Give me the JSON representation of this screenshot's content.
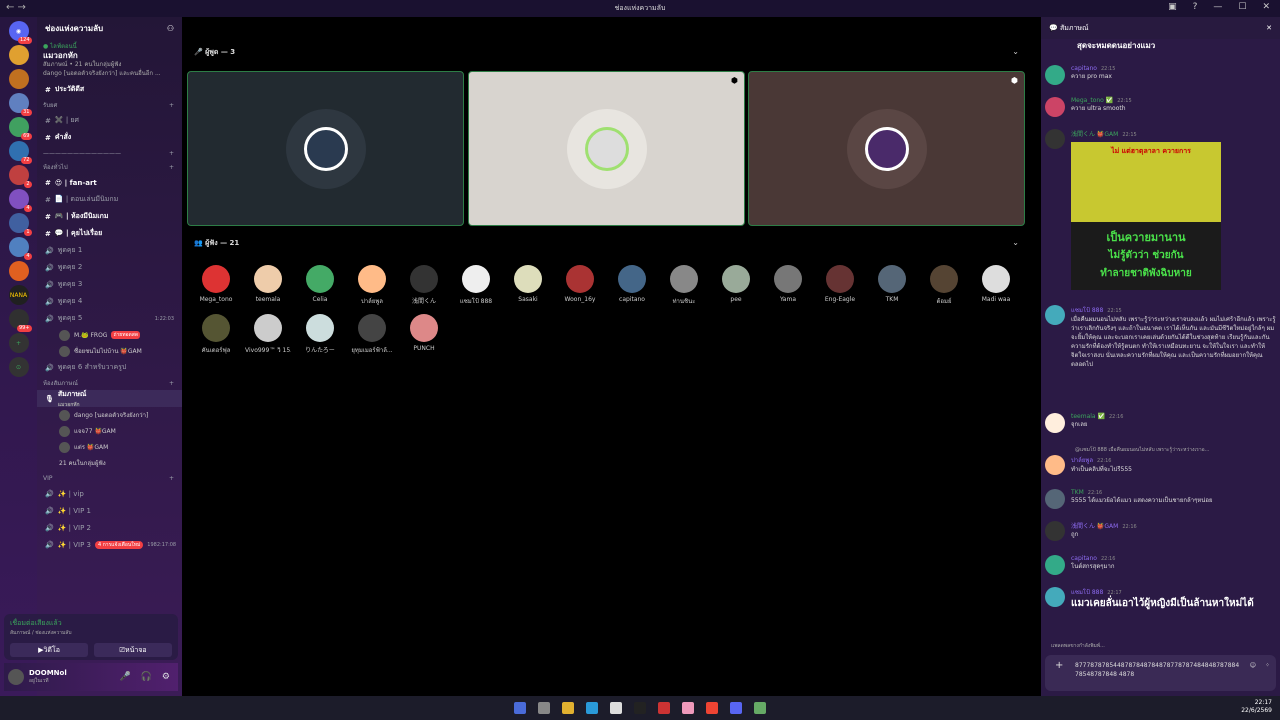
{
  "window": {
    "title": "ช่องแห่งความลับ"
  },
  "server": {
    "name": "ช่องแห่งความลับ"
  },
  "event": {
    "live_label": "● ไลฟ์ตอนนี้",
    "title": "แมวอกหัก",
    "line1": "สัมภาษณ์ • 21 คนในกลุ่มผู้ฟัง",
    "line2": "dango [นอดอตัวจริงยังกว่า] และคนอื่นอีก ..."
  },
  "channels": [
    {
      "name": "ประวัติดีส",
      "bold": true
    },
    {
      "category": "รับยศ"
    },
    {
      "name": "✖️ | ยศ"
    },
    {
      "name": "คำสั่ง",
      "bold": true
    },
    {
      "category": "ห้องทั่วไป"
    },
    {
      "name": "😍 | fan-art",
      "bold": true
    },
    {
      "name": "📄 | ตอนเล่นมีนิมกม"
    },
    {
      "name": "🎮 | ห้องมีนิมเกม",
      "bold": true
    },
    {
      "name": "💬 | คุยไปเรื่อย",
      "bold": true
    },
    {
      "name": "พูดคุย 1"
    },
    {
      "name": "พูดคุย 2"
    },
    {
      "name": "พูดคุย 3"
    },
    {
      "name": "พูดคุย 4"
    },
    {
      "name": "พูดคุย 5",
      "time": "1:22:03"
    }
  ],
  "voice5_users": [
    {
      "name": "M.🐸 FROG",
      "badge": "ถ่ายทอดสด"
    },
    {
      "name": "ซื่อยชนไม่ไปบ้าน 👹GAM"
    }
  ],
  "channels2": [
    {
      "name": "พูดคุย 6 สำหรับวาครูป"
    },
    {
      "category": "ห้องสัมภาษณ์"
    }
  ],
  "stage": {
    "name": "สัมภาษณ์",
    "sub": "แมวอกหัก",
    "users": [
      "dango [นอดอตัวจริงยังกว่า]",
      "แจจ77 👹GAM",
      "แต่ร 👹GAM",
      "21 คนในกลุ่มผู้ฟัง"
    ]
  },
  "vip": {
    "category": "VIP",
    "items": [
      "✨ | vip",
      "✨ | VIP 1",
      "✨ | VIP 2",
      "✨ | VIP 3"
    ],
    "notice": "4 การแจ้งเตือนใหม่",
    "time": "1982:17:08"
  },
  "voicebar": {
    "status": "เชื่อมต่อเสียงแล้ว",
    "where": "สัมภาษณ์ / ช่องแห่งความลับ",
    "video": "วิดีโอ",
    "screen": "หน้าจอ"
  },
  "user": {
    "name": "DOOMNol",
    "status": "อยู่ในเวที"
  },
  "speakers": {
    "label": "ผู้พูด — 3"
  },
  "audience": {
    "label": "ผู้ฟัง — 21",
    "members": [
      "Mega_tono",
      "teemala",
      "Celia",
      "ปาล์ยพูล",
      "浅間くん",
      "แซมโป้ 888",
      "Sasaki",
      "Woon_16y",
      "capitano",
      "ท่านชินะ",
      "pee",
      "Yama",
      "Eng-Eagle",
      "TKM",
      "ต้อมย์",
      "Madi waa",
      "คันเดอร์ฟุล",
      "Vivo999™ วิ 15...",
      "りんたろー",
      "ยุทุมเมอร์ฟ้าล้...",
      "PUNCH"
    ]
  },
  "chatpanel": {
    "title": "สัมภาษณ์",
    "top": "สุดจะหมดดนอย่างแมว"
  },
  "messages": [
    {
      "name": "capitano",
      "time": "22:15",
      "text": "ควาย pro max"
    },
    {
      "name": "Mega_tono ✅",
      "time": "22:15",
      "text": "ควาย ultra smooth"
    },
    {
      "name": "浅間くん 👹GAM",
      "time": "22:15",
      "text": ""
    },
    {
      "name": "แซมโป้ 888",
      "time": "22:15",
      "text": "เมื่อคืนผมนอนไม่หลับ เพราะรู้ว่าระหว่างเราจบลงแล้ว ผมไม่เศร้าอีกแล้ว เพราะรู้ว่าเราเลิกกันจริงๆ และถ้าในอนาคต เราได้เห็นกัน และมันมีชีวิตใหม่อยู่ใกล้ๆ ผมจะยิ้มให้คุณ และจะบอกเราเคยเล่นด้วยกันได้ดีในช่วงสุดท้าย เรียนรู้กันและกัน ความรักที่ต้องทำให้รู้ตนตก ทำให้เราเหมือนทะยาน จะให้ในใจเรา และทำให้จิตใจเราสงบ นั่นเหละความรักที่ผมให้คุณ และเป็นความรักที่ผมอยากให้คุณตลอดไป"
    },
    {
      "name": "teemala ✅",
      "time": "22:16",
      "text": "จุกเลย"
    },
    {
      "name": "ปาล์ยพูล",
      "time": "22:16",
      "text": "ทำเป็นคลิปที่จะไปรี555",
      "reply": "@แซมโป้ 888 เมื่อคืนผมนอนไม่หลับ เพราะรู้ว่าระหว่างเราอ..."
    },
    {
      "name": "TKM",
      "time": "22:16",
      "text": "5555 ได้แมวย้อได้แมว แสดงความเป็นชายกล้าๆหน่อย"
    },
    {
      "name": "浅間くん 👹GAM",
      "time": "22:16",
      "text": "ถูก"
    },
    {
      "name": "capitano",
      "time": "22:16",
      "text": "โนต์สกรสุดๆมาก"
    },
    {
      "name": "แซมโป้ 888",
      "time": "22:17",
      "text": "แมวเคยลั่นเอาไว้ผู้หญิงมีเป็นล้านหาใหม่ได้"
    }
  ],
  "meme": {
    "top": "ไม่ แต่ฮาตุลาลา ควายการ",
    "line1": "เป็นควายมานาน",
    "line2": "ไม่รู้ตัวว่า ช่วยกัน",
    "line3": "ทำลายชาติพังฉิบหาย"
  },
  "typing": "แพลดพลขางกำลังพิมพ์...",
  "composer": "877787878544878784878487877878748484878788478548787848 4878",
  "clock": {
    "time": "22:17",
    "date": "22/6/2569"
  },
  "colors": {
    "accent": "#3ba55c",
    "bg": "#2b1a45"
  }
}
